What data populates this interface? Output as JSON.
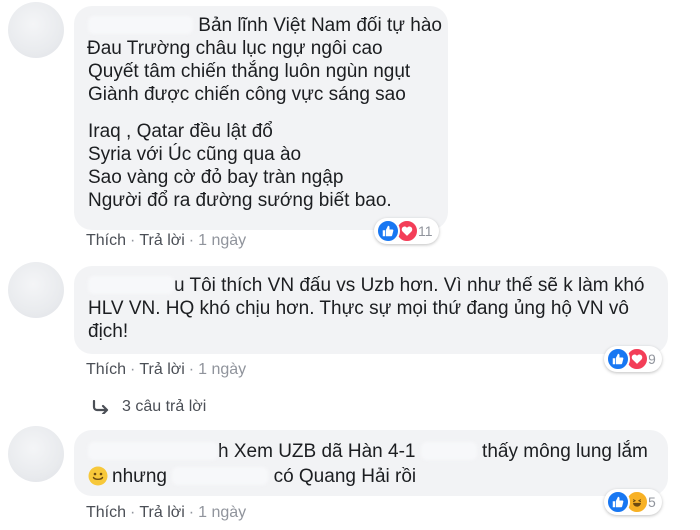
{
  "comments": [
    {
      "lines": [
        "Bản lĩnh Việt Nam đối tự hào",
        "Đau Trường châu lục ngự ngôi cao",
        "Quyết tâm chiến thắng luôn ngùn ngụt",
        "Giành được chiến công vực sáng sao",
        "Iraq , Qatar đều lật đổ",
        "Syria với Úc cũng qua ào",
        "Sao vàng cờ đỏ bay tràn ngập",
        "Người đổ ra đường sướng biết bao."
      ],
      "like_label": "Thích",
      "reply_label": "Trả lời",
      "time": "1 ngày",
      "reaction_count": "11",
      "reactions": [
        "like-icon",
        "love-icon"
      ]
    },
    {
      "lines": [
        "u Tôi thích VN đấu vs Uzb hơn. Vì như thế sẽ k làm khó",
        "HLV VN. HQ khó chịu hơn. Thực sự mọi thứ đang ủng hộ VN vô",
        "địch!"
      ],
      "like_label": "Thích",
      "reply_label": "Trả lời",
      "time": "1 ngày",
      "reaction_count": "9",
      "reactions": [
        "like-icon",
        "love-icon"
      ],
      "replies_label": "3 câu trả lời"
    },
    {
      "line1_a": "h Xem UZB dã Hàn 4-1",
      "line1_b": "thấy mông lung lắm",
      "line2_a": "nhưng",
      "line2_b": "có Quang Hải rồi",
      "like_label": "Thích",
      "reply_label": "Trả lời",
      "time": "1 ngày",
      "reaction_count": "5",
      "reactions": [
        "like-icon",
        "haha-icon"
      ]
    }
  ],
  "colors": {
    "bubble": "#f2f3f5",
    "like": "#1877f2",
    "love": "#f33e58",
    "haha": "#f7b125",
    "meta": "#90949c",
    "action": "#4b4f56"
  }
}
